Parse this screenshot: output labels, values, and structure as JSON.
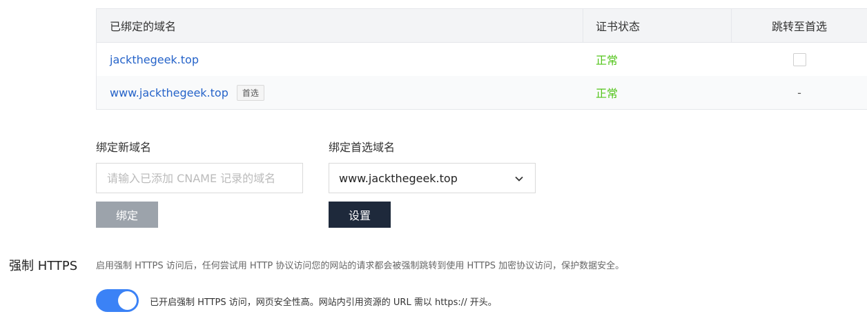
{
  "table": {
    "headers": {
      "domain": "已绑定的域名",
      "cert_status": "证书状态",
      "redirect": "跳转至首选"
    },
    "rows": [
      {
        "domain": "jackthegeek.top",
        "tag": "",
        "status": "正常",
        "redirect": "checkbox"
      },
      {
        "domain": "www.jackthegeek.top",
        "tag": "首选",
        "status": "正常",
        "redirect": "-"
      }
    ]
  },
  "bind_new": {
    "label": "绑定新域名",
    "placeholder": "请输入已添加 CNAME 记录的域名",
    "button": "绑定"
  },
  "bind_preferred": {
    "label": "绑定首选域名",
    "selected": "www.jackthegeek.top",
    "button": "设置"
  },
  "force_https": {
    "title": "强制 HTTPS",
    "description": "启用强制 HTTPS 访问后，任何尝试用 HTTP 协议访问您的网站的请求都会被强制跳转到使用 HTTPS 加密协议访问，保护数据安全。",
    "toggle_on": true,
    "toggle_text": "已开启强制 HTTPS 访问，网页安全性高。网站内引用资源的 URL 需以 https:// 开头。"
  },
  "colors": {
    "link": "#2563c9",
    "ok": "#52c41a",
    "toggle": "#3b82f6",
    "primary_btn": "#1e293b",
    "disabled_btn": "#9ca3ab"
  },
  "icons": {
    "select_caret": "chevron-down-icon"
  }
}
